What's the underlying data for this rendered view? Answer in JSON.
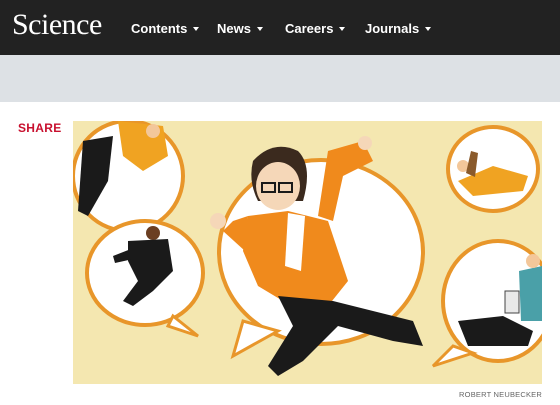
{
  "header": {
    "logo": "Science",
    "nav": [
      {
        "label": "Contents"
      },
      {
        "label": "News"
      },
      {
        "label": "Careers"
      },
      {
        "label": "Journals"
      }
    ]
  },
  "article": {
    "share_label": "SHARE",
    "image_credit": "ROBERT NEUBECKER"
  },
  "colors": {
    "header_bg": "#222222",
    "banner_bg": "#dde1e5",
    "share_red": "#c8102e",
    "illustration_bg": "#f4e7b0",
    "accent_orange": "#f08a1c"
  },
  "icons": [
    "chevron-down-icon"
  ]
}
